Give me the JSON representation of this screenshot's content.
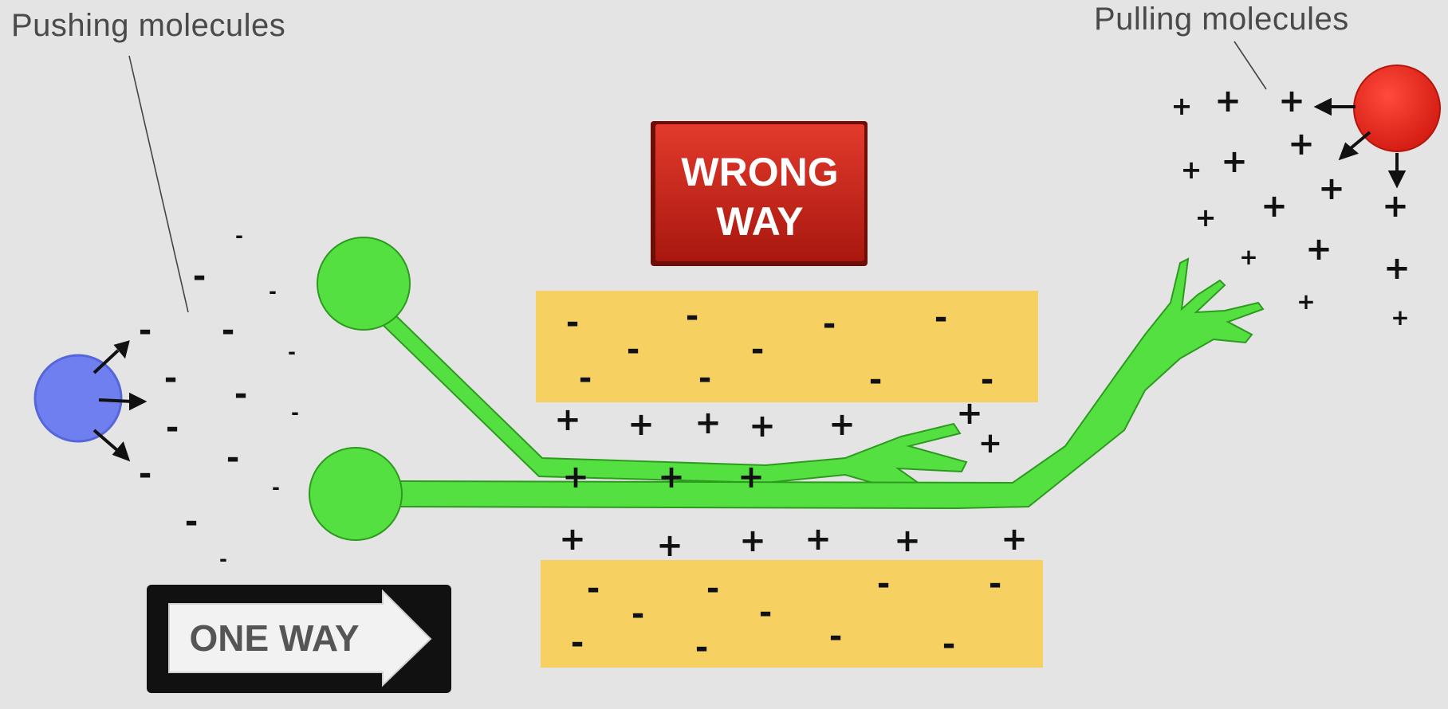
{
  "labels": {
    "pushing": "Pushing molecules",
    "pulling": "Pulling molecules"
  },
  "signs": {
    "wrong_way": [
      "WRONG",
      "WAY"
    ],
    "one_way": "ONE WAY"
  },
  "symbols": {
    "plus": "+",
    "minus": "-"
  },
  "colors": {
    "background": "#e4e4e4",
    "pushing_molecule": "#6f7ff0",
    "pulling_molecule": "#e5241b",
    "axon": "#55e041",
    "axon_outline": "#2d9a1f",
    "tissue_band": "#f6d061",
    "wrong_way_sign": "#cc2418",
    "one_way_sign": "#111111"
  }
}
